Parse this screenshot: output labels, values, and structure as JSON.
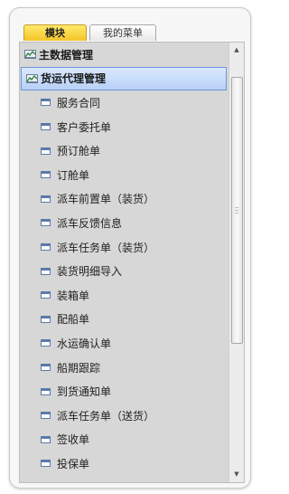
{
  "tabs": [
    {
      "label": "模块",
      "active": true
    },
    {
      "label": "我的菜单",
      "active": false
    }
  ],
  "tree": {
    "group_icon": "chart-icon",
    "child_icon": "window-icon",
    "rows": [
      {
        "label": "主数据管理",
        "type": "group",
        "selected": false
      },
      {
        "label": "货运代理管理",
        "type": "group",
        "selected": true
      },
      {
        "label": "服务合同",
        "type": "child"
      },
      {
        "label": "客户委托单",
        "type": "child"
      },
      {
        "label": "预订舱单",
        "type": "child"
      },
      {
        "label": "订舱单",
        "type": "child"
      },
      {
        "label": "派车前置单（装货）",
        "type": "child"
      },
      {
        "label": "派车反馈信息",
        "type": "child"
      },
      {
        "label": "派车任务单（装货）",
        "type": "child"
      },
      {
        "label": "装货明细导入",
        "type": "child"
      },
      {
        "label": "装箱单",
        "type": "child"
      },
      {
        "label": "配船单",
        "type": "child"
      },
      {
        "label": "水运确认单",
        "type": "child"
      },
      {
        "label": "船期跟踪",
        "type": "child"
      },
      {
        "label": "到货通知单",
        "type": "child"
      },
      {
        "label": "派车任务单（送货）",
        "type": "child"
      },
      {
        "label": "签收单",
        "type": "child"
      },
      {
        "label": "投保单",
        "type": "child"
      }
    ]
  },
  "colors": {
    "active_tab": "#f4c528",
    "selection": "#b7d1f7",
    "panel_bg": "#d7d7d7"
  }
}
